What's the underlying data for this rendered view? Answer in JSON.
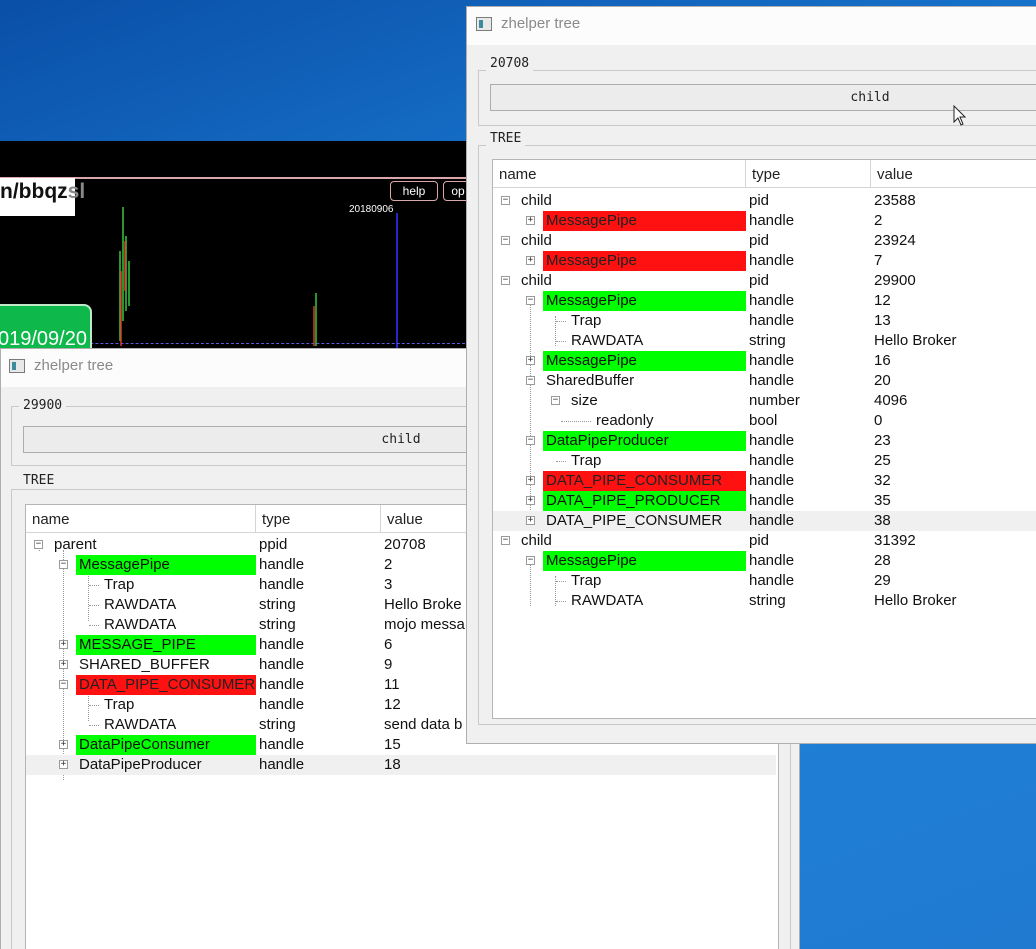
{
  "bg_app": {
    "url_text": "n/bbqz",
    "url_ghost": "sl",
    "help_label": "help",
    "op_label": "op",
    "date_label": "20180906",
    "green_box_text": "019/09/20"
  },
  "win_left": {
    "title": "zhelper tree",
    "pid_group_label": "29900",
    "child_button_label": "child",
    "tree_group_label": "TREE",
    "headers": {
      "name": "name",
      "type": "type",
      "value": "value"
    },
    "rows": [
      {
        "name": "parent",
        "type": "ppid",
        "value": "20708"
      },
      {
        "name": "MessagePipe",
        "type": "handle",
        "value": "2"
      },
      {
        "name": "Trap",
        "type": "handle",
        "value": "3"
      },
      {
        "name": "RAWDATA",
        "type": "string",
        "value": "Hello Broke"
      },
      {
        "name": "RAWDATA",
        "type": "string",
        "value": "mojo messa"
      },
      {
        "name": "MESSAGE_PIPE",
        "type": "handle",
        "value": "6"
      },
      {
        "name": "SHARED_BUFFER",
        "type": "handle",
        "value": "9"
      },
      {
        "name": "DATA_PIPE_CONSUMER",
        "type": "handle",
        "value": "11"
      },
      {
        "name": "Trap",
        "type": "handle",
        "value": "12"
      },
      {
        "name": "RAWDATA",
        "type": "string",
        "value": "send data b"
      },
      {
        "name": "DataPipeConsumer",
        "type": "handle",
        "value": "15"
      },
      {
        "name": "DataPipeProducer",
        "type": "handle",
        "value": "18"
      }
    ]
  },
  "win_right": {
    "title": "zhelper tree",
    "pid_group_label": "20708",
    "child_button_label": "child",
    "tree_group_label": "TREE",
    "headers": {
      "name": "name",
      "type": "type",
      "value": "value"
    },
    "rows": [
      {
        "name": "child",
        "type": "pid",
        "value": "23588"
      },
      {
        "name": "MessagePipe",
        "type": "handle",
        "value": "2"
      },
      {
        "name": "child",
        "type": "pid",
        "value": "23924"
      },
      {
        "name": "MessagePipe",
        "type": "handle",
        "value": "7"
      },
      {
        "name": "child",
        "type": "pid",
        "value": "29900"
      },
      {
        "name": "MessagePipe",
        "type": "handle",
        "value": "12"
      },
      {
        "name": "Trap",
        "type": "handle",
        "value": "13"
      },
      {
        "name": "RAWDATA",
        "type": "string",
        "value": "Hello Broker"
      },
      {
        "name": "MessagePipe",
        "type": "handle",
        "value": "16"
      },
      {
        "name": "SharedBuffer",
        "type": "handle",
        "value": "20"
      },
      {
        "name": "size",
        "type": "number",
        "value": "4096"
      },
      {
        "name": "readonly",
        "type": "bool",
        "value": "0"
      },
      {
        "name": "DataPipeProducer",
        "type": "handle",
        "value": "23"
      },
      {
        "name": "Trap",
        "type": "handle",
        "value": "25"
      },
      {
        "name": "DATA_PIPE_CONSUMER",
        "type": "handle",
        "value": "32"
      },
      {
        "name": "DATA_PIPE_PRODUCER",
        "type": "handle",
        "value": "35"
      },
      {
        "name": "DATA_PIPE_CONSUMER",
        "type": "handle",
        "value": "38"
      },
      {
        "name": "child",
        "type": "pid",
        "value": "31392"
      },
      {
        "name": "MessagePipe",
        "type": "handle",
        "value": "28"
      },
      {
        "name": "Trap",
        "type": "handle",
        "value": "29"
      },
      {
        "name": "RAWDATA",
        "type": "string",
        "value": "Hello Broker"
      }
    ]
  },
  "colors": {
    "green_highlight": "#00ff00",
    "red_highlight": "#ff1111",
    "desktop_blue": "#1c78d2"
  }
}
